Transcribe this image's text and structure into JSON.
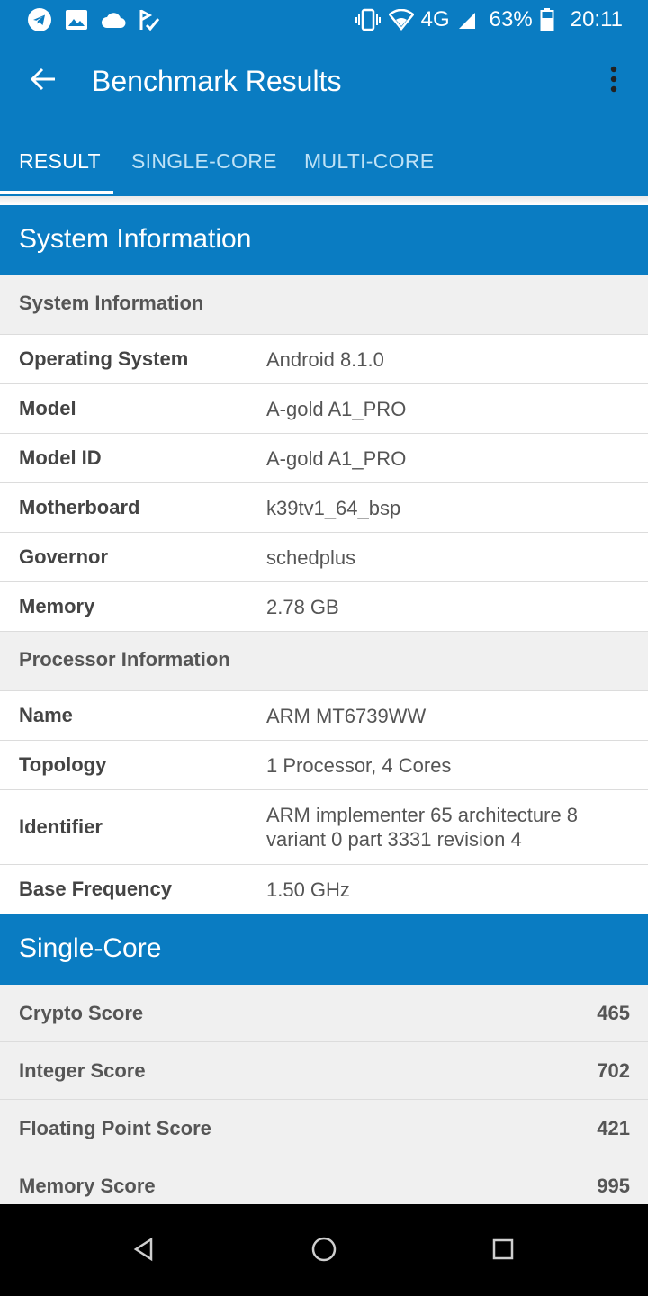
{
  "status_bar": {
    "battery": "63%",
    "time": "20:11",
    "network": "4G",
    "left_icons": [
      "telegram-icon",
      "image-icon",
      "cloud-icon",
      "check-flag-icon"
    ],
    "right_icons": [
      "vibrate-icon",
      "wifi-icon",
      "signal-icon",
      "battery-icon"
    ]
  },
  "app_bar": {
    "title": "Benchmark Results",
    "back_icon": "arrow-left-icon",
    "menu_icon": "more-vert-icon"
  },
  "tabs": [
    {
      "label": "RESULT",
      "active": true
    },
    {
      "label": "SINGLE-CORE",
      "active": false
    },
    {
      "label": "MULTI-CORE",
      "active": false
    }
  ],
  "system_information": {
    "section_title": "System Information",
    "system_group": {
      "title": "System Information",
      "rows": [
        {
          "label": "Operating System",
          "value": "Android 8.1.0"
        },
        {
          "label": "Model",
          "value": "A-gold A1_PRO"
        },
        {
          "label": "Model ID",
          "value": "A-gold A1_PRO"
        },
        {
          "label": "Motherboard",
          "value": "k39tv1_64_bsp"
        },
        {
          "label": "Governor",
          "value": "schedplus"
        },
        {
          "label": "Memory",
          "value": "2.78 GB"
        }
      ]
    },
    "processor_group": {
      "title": "Processor Information",
      "rows": [
        {
          "label": "Name",
          "value": "ARM MT6739WW"
        },
        {
          "label": "Topology",
          "value": "1 Processor, 4 Cores"
        },
        {
          "label": "Identifier",
          "value": "ARM implementer 65 architecture 8 variant 0 part 3331 revision 4"
        },
        {
          "label": "Base Frequency",
          "value": "1.50 GHz"
        }
      ]
    }
  },
  "single_core": {
    "section_title": "Single-Core",
    "scores": [
      {
        "label": "Crypto Score",
        "value": "465"
      },
      {
        "label": "Integer Score",
        "value": "702"
      },
      {
        "label": "Floating Point Score",
        "value": "421"
      },
      {
        "label": "Memory Score",
        "value": "995"
      }
    ]
  },
  "nav_bar": {
    "icons": [
      "back-triangle-icon",
      "home-circle-icon",
      "recents-square-icon"
    ]
  },
  "colors": {
    "primary": "#0a7cc2",
    "tab_inactive": "#bfe2f6",
    "row_alt": "#f0f0f0"
  }
}
